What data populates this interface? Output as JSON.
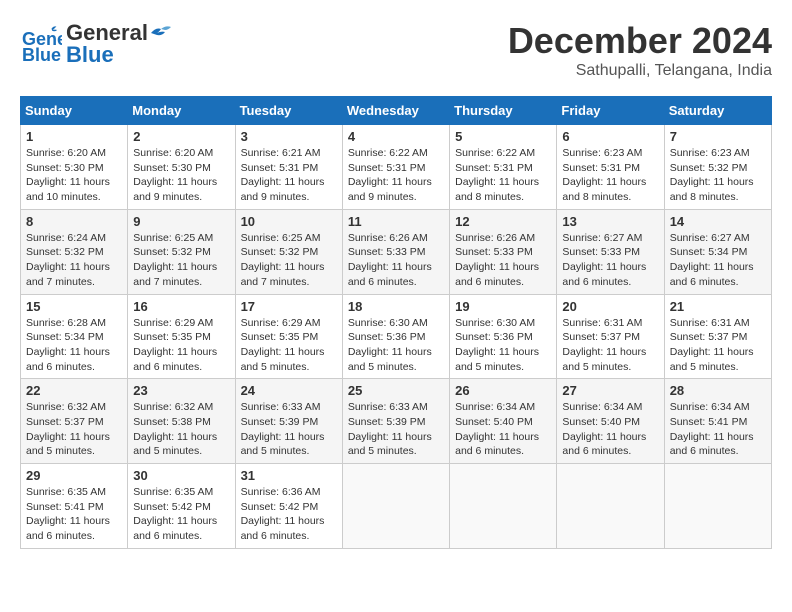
{
  "header": {
    "logo_line1": "General",
    "logo_line2": "Blue",
    "title": "December 2024",
    "subtitle": "Sathupalli, Telangana, India"
  },
  "weekdays": [
    "Sunday",
    "Monday",
    "Tuesday",
    "Wednesday",
    "Thursday",
    "Friday",
    "Saturday"
  ],
  "weeks": [
    [
      {
        "day": "1",
        "sunrise": "6:20 AM",
        "sunset": "5:30 PM",
        "daylight": "11 hours and 10 minutes."
      },
      {
        "day": "2",
        "sunrise": "6:20 AM",
        "sunset": "5:30 PM",
        "daylight": "11 hours and 9 minutes."
      },
      {
        "day": "3",
        "sunrise": "6:21 AM",
        "sunset": "5:31 PM",
        "daylight": "11 hours and 9 minutes."
      },
      {
        "day": "4",
        "sunrise": "6:22 AM",
        "sunset": "5:31 PM",
        "daylight": "11 hours and 9 minutes."
      },
      {
        "day": "5",
        "sunrise": "6:22 AM",
        "sunset": "5:31 PM",
        "daylight": "11 hours and 8 minutes."
      },
      {
        "day": "6",
        "sunrise": "6:23 AM",
        "sunset": "5:31 PM",
        "daylight": "11 hours and 8 minutes."
      },
      {
        "day": "7",
        "sunrise": "6:23 AM",
        "sunset": "5:32 PM",
        "daylight": "11 hours and 8 minutes."
      }
    ],
    [
      {
        "day": "8",
        "sunrise": "6:24 AM",
        "sunset": "5:32 PM",
        "daylight": "11 hours and 7 minutes."
      },
      {
        "day": "9",
        "sunrise": "6:25 AM",
        "sunset": "5:32 PM",
        "daylight": "11 hours and 7 minutes."
      },
      {
        "day": "10",
        "sunrise": "6:25 AM",
        "sunset": "5:32 PM",
        "daylight": "11 hours and 7 minutes."
      },
      {
        "day": "11",
        "sunrise": "6:26 AM",
        "sunset": "5:33 PM",
        "daylight": "11 hours and 6 minutes."
      },
      {
        "day": "12",
        "sunrise": "6:26 AM",
        "sunset": "5:33 PM",
        "daylight": "11 hours and 6 minutes."
      },
      {
        "day": "13",
        "sunrise": "6:27 AM",
        "sunset": "5:33 PM",
        "daylight": "11 hours and 6 minutes."
      },
      {
        "day": "14",
        "sunrise": "6:27 AM",
        "sunset": "5:34 PM",
        "daylight": "11 hours and 6 minutes."
      }
    ],
    [
      {
        "day": "15",
        "sunrise": "6:28 AM",
        "sunset": "5:34 PM",
        "daylight": "11 hours and 6 minutes."
      },
      {
        "day": "16",
        "sunrise": "6:29 AM",
        "sunset": "5:35 PM",
        "daylight": "11 hours and 6 minutes."
      },
      {
        "day": "17",
        "sunrise": "6:29 AM",
        "sunset": "5:35 PM",
        "daylight": "11 hours and 5 minutes."
      },
      {
        "day": "18",
        "sunrise": "6:30 AM",
        "sunset": "5:36 PM",
        "daylight": "11 hours and 5 minutes."
      },
      {
        "day": "19",
        "sunrise": "6:30 AM",
        "sunset": "5:36 PM",
        "daylight": "11 hours and 5 minutes."
      },
      {
        "day": "20",
        "sunrise": "6:31 AM",
        "sunset": "5:37 PM",
        "daylight": "11 hours and 5 minutes."
      },
      {
        "day": "21",
        "sunrise": "6:31 AM",
        "sunset": "5:37 PM",
        "daylight": "11 hours and 5 minutes."
      }
    ],
    [
      {
        "day": "22",
        "sunrise": "6:32 AM",
        "sunset": "5:37 PM",
        "daylight": "11 hours and 5 minutes."
      },
      {
        "day": "23",
        "sunrise": "6:32 AM",
        "sunset": "5:38 PM",
        "daylight": "11 hours and 5 minutes."
      },
      {
        "day": "24",
        "sunrise": "6:33 AM",
        "sunset": "5:39 PM",
        "daylight": "11 hours and 5 minutes."
      },
      {
        "day": "25",
        "sunrise": "6:33 AM",
        "sunset": "5:39 PM",
        "daylight": "11 hours and 5 minutes."
      },
      {
        "day": "26",
        "sunrise": "6:34 AM",
        "sunset": "5:40 PM",
        "daylight": "11 hours and 6 minutes."
      },
      {
        "day": "27",
        "sunrise": "6:34 AM",
        "sunset": "5:40 PM",
        "daylight": "11 hours and 6 minutes."
      },
      {
        "day": "28",
        "sunrise": "6:34 AM",
        "sunset": "5:41 PM",
        "daylight": "11 hours and 6 minutes."
      }
    ],
    [
      {
        "day": "29",
        "sunrise": "6:35 AM",
        "sunset": "5:41 PM",
        "daylight": "11 hours and 6 minutes."
      },
      {
        "day": "30",
        "sunrise": "6:35 AM",
        "sunset": "5:42 PM",
        "daylight": "11 hours and 6 minutes."
      },
      {
        "day": "31",
        "sunrise": "6:36 AM",
        "sunset": "5:42 PM",
        "daylight": "11 hours and 6 minutes."
      },
      null,
      null,
      null,
      null
    ]
  ]
}
